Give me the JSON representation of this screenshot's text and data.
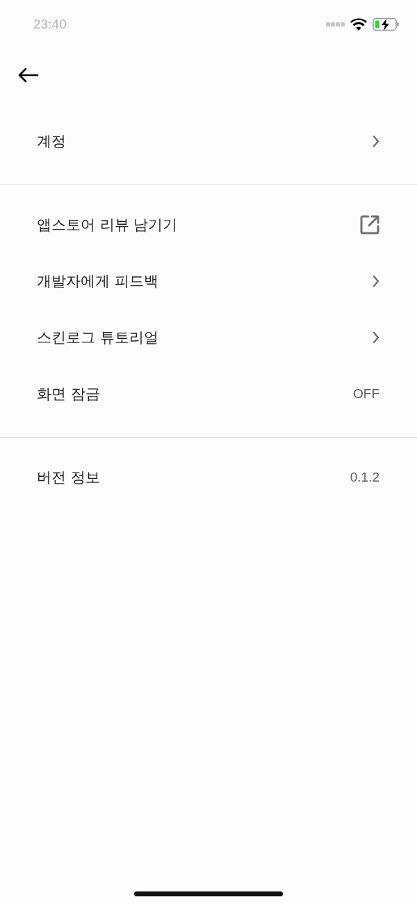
{
  "status_bar": {
    "time": "23:40"
  },
  "sections": [
    {
      "items": [
        {
          "label": "계정",
          "kind": "link"
        }
      ]
    },
    {
      "items": [
        {
          "label": "앱스토어 리뷰 남기기",
          "kind": "external"
        },
        {
          "label": "개발자에게 피드백",
          "kind": "link"
        },
        {
          "label": "스킨로그 튜토리얼",
          "kind": "link"
        },
        {
          "label": "화면 잠금",
          "kind": "value",
          "value": "OFF"
        }
      ]
    },
    {
      "items": [
        {
          "label": "버전 정보",
          "kind": "value",
          "value": "0.1.2"
        }
      ]
    }
  ]
}
